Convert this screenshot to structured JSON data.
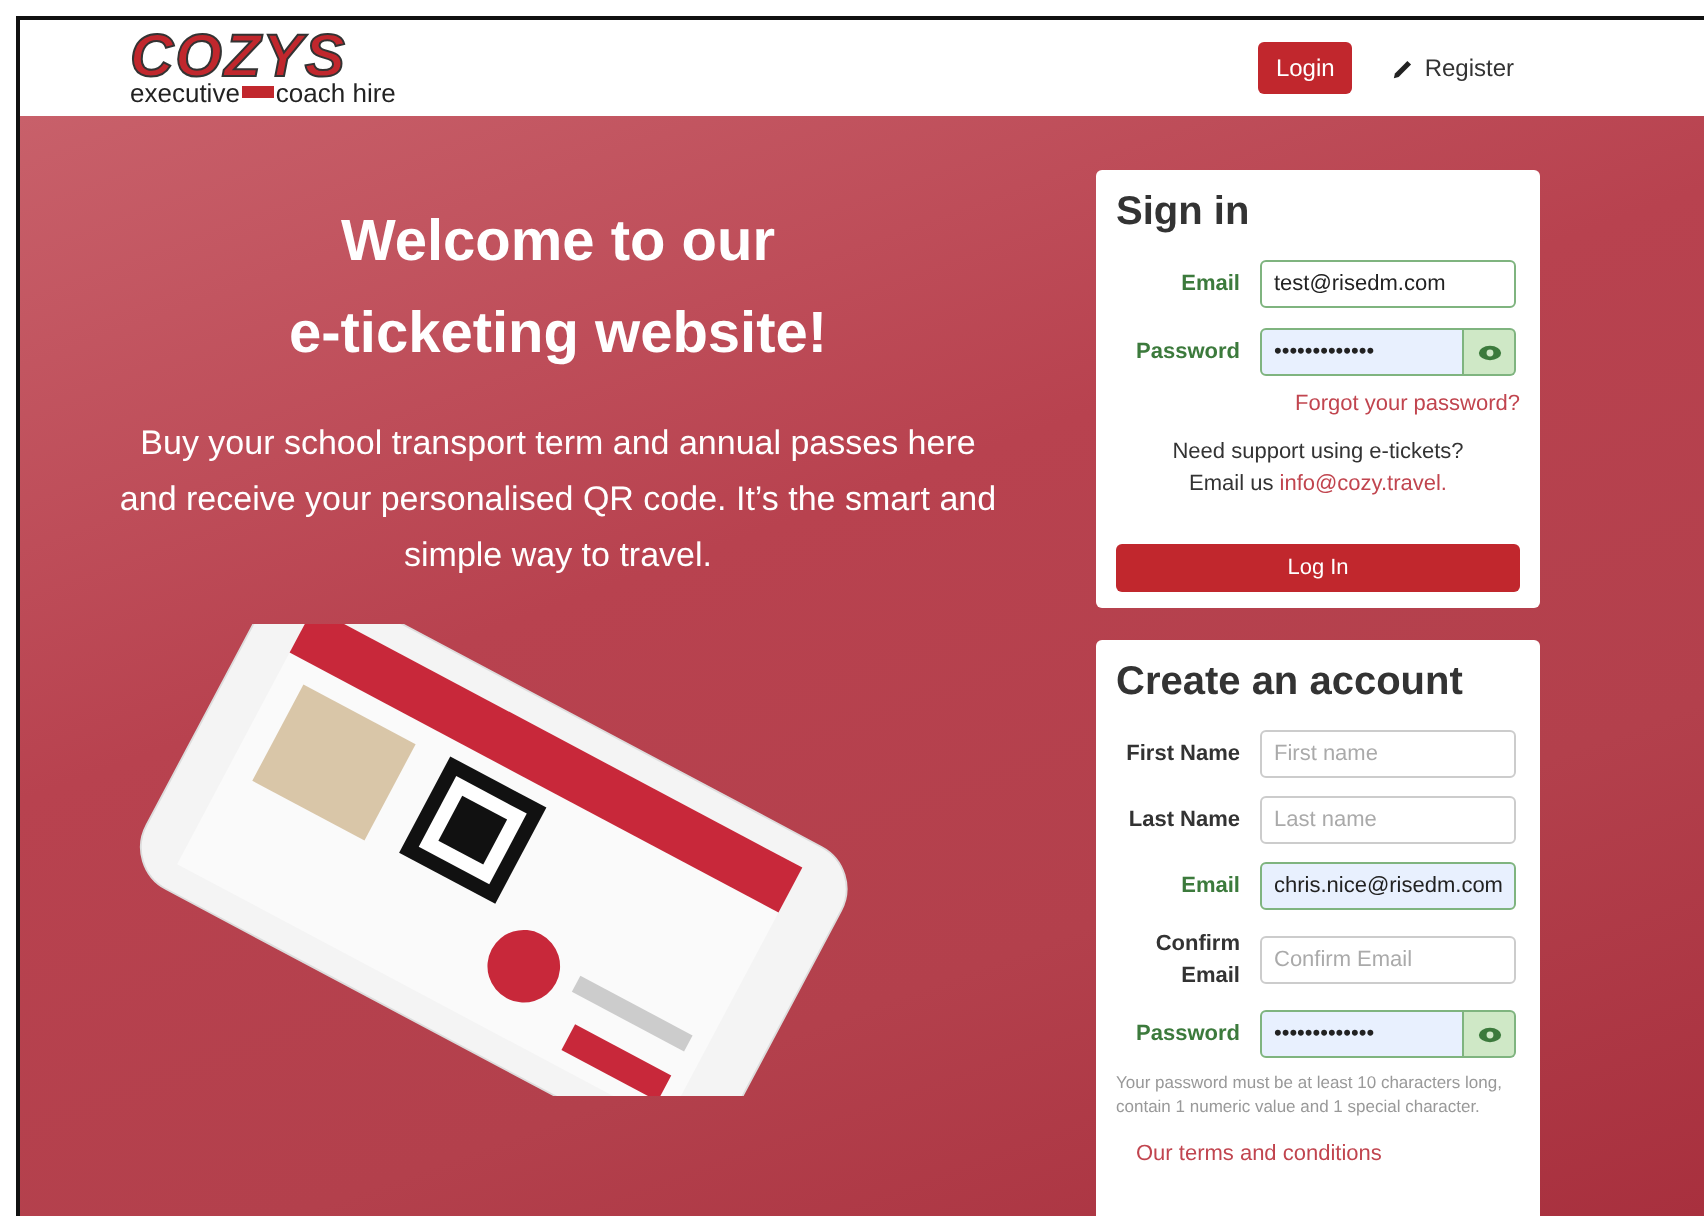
{
  "header": {
    "logo": {
      "wordmark": "COZYS",
      "tagline_left": "executive",
      "tagline_right": "coach hire"
    },
    "nav": [
      {
        "label": "Login",
        "kind": "button"
      },
      {
        "label": "Register",
        "kind": "link"
      }
    ]
  },
  "hero": {
    "title_lines": [
      "Welcome to our",
      "e-ticketing website!"
    ],
    "text": "Buy your school transport term and annual passes here and receive your personalised QR code. It’s the smart and simple way to travel."
  },
  "sign_in": {
    "title": "Sign in",
    "fields": [
      {
        "label": "Email",
        "kind": "text",
        "value": "test@risedm.com",
        "valid": true,
        "autofilled": false
      },
      {
        "label": "Password",
        "kind": "password",
        "value": "•••••••••••••",
        "valid": true,
        "autofilled": true
      }
    ],
    "forgot_link": "Forgot your password?",
    "support_text": "Need support using e-tickets?",
    "email_prefix": "Email us",
    "email_link": "info@cozy.travel.",
    "button": "Log In"
  },
  "create_account": {
    "title": "Create an account",
    "fields": [
      {
        "label": "First Name",
        "kind": "text",
        "placeholder": "First name",
        "valid": false,
        "autofilled": false
      },
      {
        "label": "Last Name",
        "kind": "text",
        "placeholder": "Last name",
        "valid": false,
        "autofilled": false
      },
      {
        "label": "Email",
        "kind": "text",
        "value": "chris.nice@risedm.com",
        "valid": true,
        "autofilled": true
      },
      {
        "label": "Confirm Email",
        "kind": "text",
        "placeholder": "Confirm Email",
        "valid": false,
        "autofilled": false
      },
      {
        "label": "Password",
        "kind": "password",
        "value": "•••••••••••••",
        "valid": true,
        "autofilled": true
      }
    ],
    "password_hint": "Your password must be at least 10 characters long, contain 1 numeric value and 1 special character.",
    "terms_link": "Our terms and conditions"
  }
}
